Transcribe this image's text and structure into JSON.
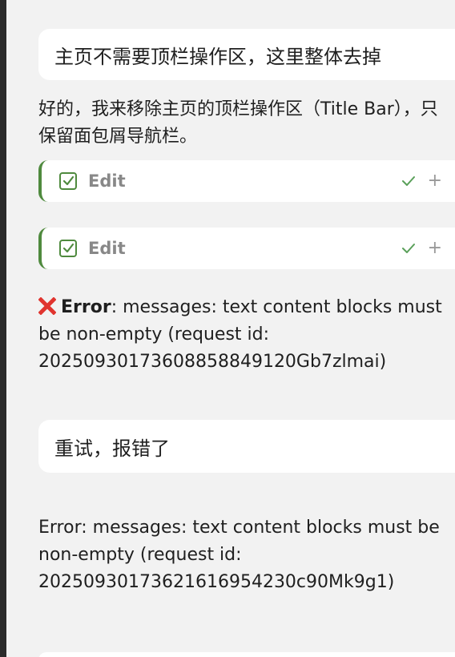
{
  "messages": {
    "user_1": "主页不需要顶栏操作区，这里整体去掉",
    "assistant_1": "好的，我来移除主页的顶栏操作区（Title Bar），只保留面包屑导航栏。",
    "edit_cards": [
      {
        "label": "Edit",
        "icon": "checkbox-edit-icon",
        "status_icon": "check-icon",
        "action_icon": "plus-icon"
      },
      {
        "label": "Edit",
        "icon": "checkbox-edit-icon",
        "status_icon": "check-icon",
        "action_icon": "plus-icon"
      }
    ],
    "error_1": {
      "icon": "cross-mark-icon",
      "title": "Error",
      "text": ": messages: text content blocks must be non-empty (request id: 20250930173608858849120Gb7zlmai)"
    },
    "user_2": "重试，报错了",
    "error_2": "Error: messages: text content blocks must be non-empty (request id: 20250930173621616954230c90Mk9g1)"
  },
  "colors": {
    "background": "#f2f2f2",
    "bubble": "#ffffff",
    "edit_accent": "#4f8a3e",
    "error_red": "#e0342f",
    "muted_text": "#888888"
  }
}
